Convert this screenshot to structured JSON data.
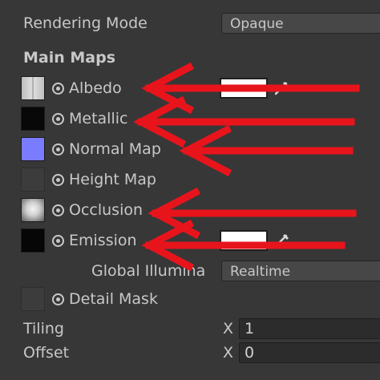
{
  "rendering_mode": {
    "label": "Rendering Mode",
    "value": "Opaque"
  },
  "section_title": "Main Maps",
  "maps": [
    {
      "label": "Albedo"
    },
    {
      "label": "Metallic"
    },
    {
      "label": "Normal Map"
    },
    {
      "label": "Height Map"
    },
    {
      "label": "Occlusion"
    },
    {
      "label": "Emission"
    }
  ],
  "global_illumination": {
    "label": "Global Illumina",
    "value": "Realtime"
  },
  "detail_mask": {
    "label": "Detail Mask"
  },
  "tiling": {
    "label": "Tiling",
    "axis": "X",
    "value": "1"
  },
  "offset": {
    "label": "Offset",
    "axis": "X",
    "value": "0"
  },
  "colors": {
    "background": "#373737",
    "annotation_arrow": "#e8141c",
    "normal_map_thumb": "#7c7cff",
    "swatch": "#ffffff"
  }
}
